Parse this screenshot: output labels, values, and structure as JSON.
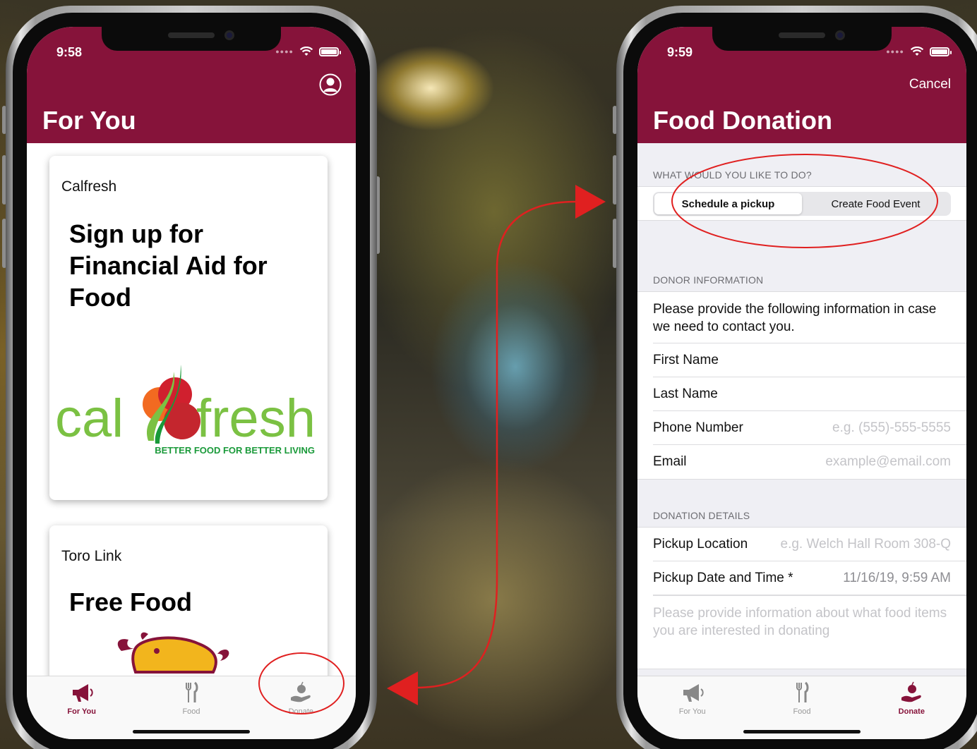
{
  "left_phone": {
    "status": {
      "time": "9:58"
    },
    "header": {
      "title": "For You",
      "profile_icon": "person-circle-icon"
    },
    "cards": [
      {
        "subtitle": "Calfresh",
        "heading": "Sign up for Financial Aid for Food",
        "logo": {
          "word_left": "cal",
          "word_right": "fresh",
          "tagline": "BETTER FOOD FOR BETTER LIVING"
        }
      },
      {
        "subtitle": "Toro Link",
        "heading": "Free Food",
        "logo": "bull-logo"
      }
    ],
    "tabs": [
      {
        "label": "For You",
        "icon": "megaphone-icon",
        "active": true
      },
      {
        "label": "Food",
        "icon": "fork-knife-icon",
        "active": false
      },
      {
        "label": "Donate",
        "icon": "donate-hand-apple-icon",
        "active": false
      }
    ]
  },
  "right_phone": {
    "status": {
      "time": "9:59"
    },
    "header": {
      "title": "Food Donation",
      "cancel_label": "Cancel"
    },
    "action_section": {
      "header": "WHAT WOULD YOU LIKE TO DO?",
      "options": [
        "Schedule a pickup",
        "Create Food Event"
      ],
      "selected": "Schedule a pickup"
    },
    "donor_section": {
      "header": "DONOR INFORMATION",
      "info": "Please provide the following information in case we need to contact you.",
      "fields": [
        {
          "label": "First Name",
          "placeholder": ""
        },
        {
          "label": "Last Name",
          "placeholder": ""
        },
        {
          "label": "Phone Number",
          "placeholder": "e.g. (555)-555-5555"
        },
        {
          "label": "Email",
          "placeholder": "example@email.com"
        }
      ]
    },
    "donation_section": {
      "header": "DONATION DETAILS",
      "pickup_location": {
        "label": "Pickup Location",
        "placeholder": "e.g. Welch Hall Room 308-Q"
      },
      "pickup_datetime": {
        "label": "Pickup Date and Time *",
        "value": "11/16/19, 9:59 AM"
      },
      "notes_placeholder": "Please provide information about what food items you are interested in donating"
    },
    "tabs": [
      {
        "label": "For You",
        "icon": "megaphone-icon",
        "active": false
      },
      {
        "label": "Food",
        "icon": "fork-knife-icon",
        "active": false
      },
      {
        "label": "Donate",
        "icon": "donate-hand-apple-icon",
        "active": true
      }
    ]
  },
  "colors": {
    "brand": "#86133a",
    "annotation": "#e02020",
    "calfresh_green": "#7bc143",
    "calfresh_dark_green": "#1a9a3a"
  }
}
